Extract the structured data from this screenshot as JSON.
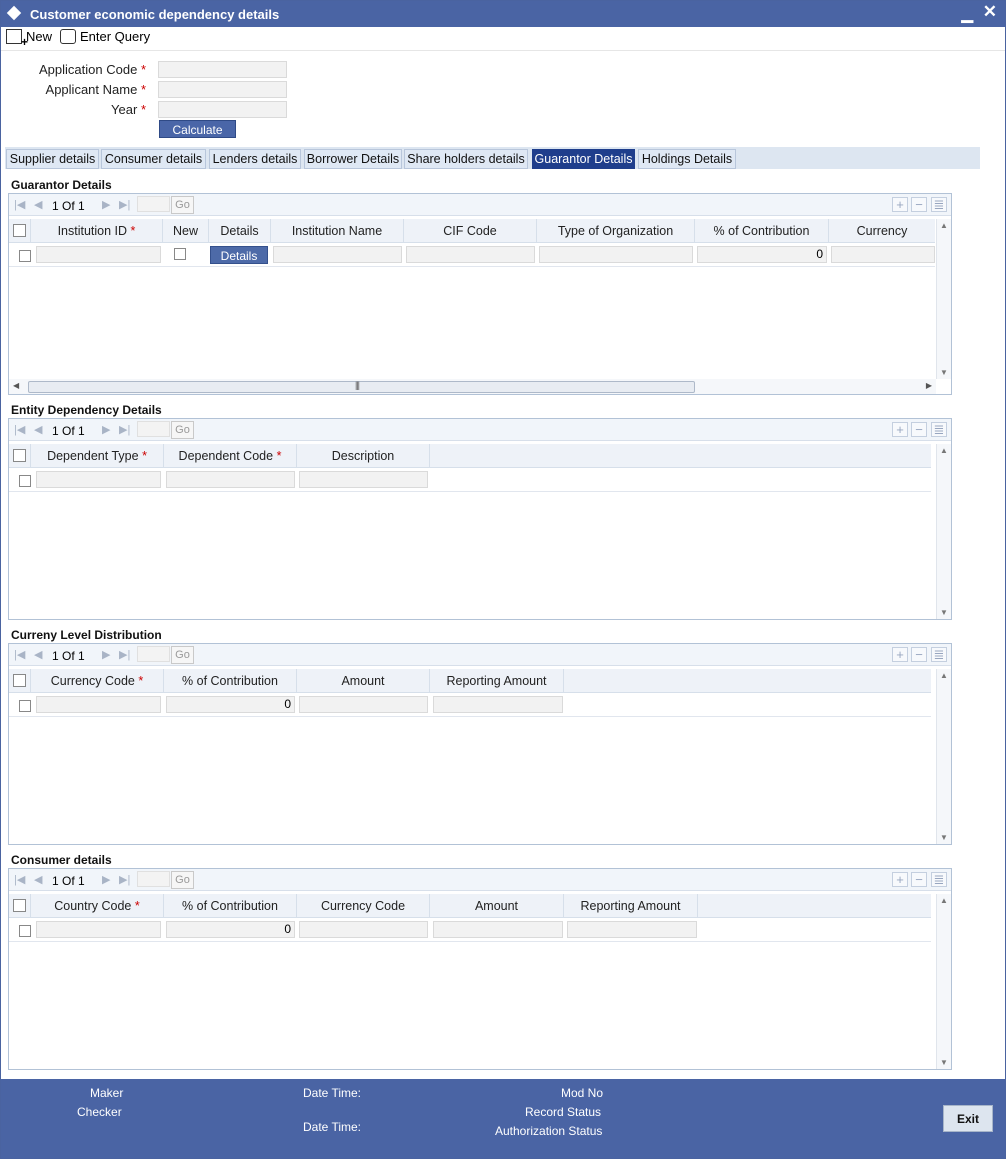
{
  "window": {
    "title": "Customer economic dependency details"
  },
  "toolbar": {
    "new_label": "New",
    "enter_query_label": "Enter Query"
  },
  "form": {
    "application_code_label": "Application Code",
    "applicant_name_label": "Applicant Name",
    "year_label": "Year",
    "required_marker": "*",
    "calculate_label": "Calculate"
  },
  "tabs": [
    {
      "label": "Supplier details"
    },
    {
      "label": "Consumer details"
    },
    {
      "label": "Lenders details"
    },
    {
      "label": "Borrower Details"
    },
    {
      "label": "Share holders details"
    },
    {
      "label": "Guarantor Details",
      "active": true
    },
    {
      "label": "Holdings Details"
    }
  ],
  "pager": {
    "current": "1",
    "of_label": "Of",
    "total": "1",
    "go_label": "Go"
  },
  "guarantor": {
    "title": "Guarantor Details",
    "columns": [
      "Institution ID",
      "New",
      "Details",
      "Institution Name",
      "CIF Code",
      "Type of Organization",
      "% of Contribution",
      "Currency"
    ],
    "row": {
      "details_button": "Details",
      "contribution": "0"
    }
  },
  "entity": {
    "title": "Entity Dependency Details",
    "columns": [
      "Dependent Type",
      "Dependent Code",
      "Description"
    ]
  },
  "currency": {
    "title": "Curreny Level Distribution",
    "columns": [
      "Currency Code",
      "% of Contribution",
      "Amount",
      "Reporting Amount"
    ],
    "row": {
      "contribution": "0"
    }
  },
  "consumer": {
    "title": "Consumer details",
    "columns": [
      "Country Code",
      "% of Contribution",
      "Currency Code",
      "Amount",
      "Reporting Amount"
    ],
    "row": {
      "contribution": "0"
    }
  },
  "footer": {
    "maker": "Maker",
    "checker": "Checker",
    "date_time_1": "Date Time:",
    "date_time_2": "Date Time:",
    "mod_no": "Mod No",
    "record_status": "Record Status",
    "authorization_status": "Authorization Status",
    "exit_label": "Exit"
  }
}
